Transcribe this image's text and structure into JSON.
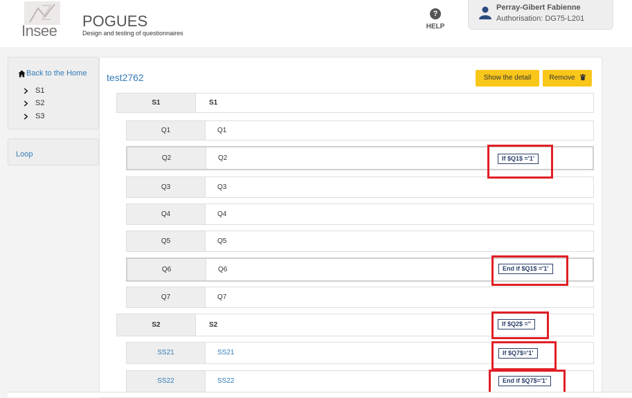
{
  "header": {
    "logo_text": "Insee",
    "app_title": "POGUES",
    "app_subtitle": "Design and testing of questionnaires",
    "help_label": "HELP",
    "user_name": "Perray-Gibert Fabienne",
    "user_authorisation": "Authorisation: DG75-L201"
  },
  "sidebar": {
    "home_label": "Back to the Home",
    "items": [
      "S1",
      "S2",
      "S3"
    ],
    "loop_label": "Loop"
  },
  "main": {
    "questionnaire_title": "test2762",
    "show_detail_label": "Show the detail",
    "remove_label": "Remove",
    "rows": [
      {
        "id": "S1",
        "label": "S1",
        "kind": "sequence"
      },
      {
        "id": "Q1",
        "label": "Q1",
        "kind": "question"
      },
      {
        "id": "Q2",
        "label": "Q2",
        "kind": "question",
        "filter": "If $Q1$ ='1'"
      },
      {
        "id": "Q3",
        "label": "Q3",
        "kind": "question"
      },
      {
        "id": "Q4",
        "label": "Q4",
        "kind": "question"
      },
      {
        "id": "Q5",
        "label": "Q5",
        "kind": "question"
      },
      {
        "id": "Q6",
        "label": "Q6",
        "kind": "question",
        "filter": "End if $Q1$ ='1'"
      },
      {
        "id": "Q7",
        "label": "Q7",
        "kind": "question"
      },
      {
        "id": "S2",
        "label": "S2",
        "kind": "sequence",
        "filter": "If $Q2$ =''"
      },
      {
        "id": "SS21",
        "label": "SS21",
        "kind": "subsequence",
        "filter": "If $Q7$='1'"
      },
      {
        "id": "SS22",
        "label": "SS22",
        "kind": "subsequence",
        "filter": "End if $Q7$='1'"
      }
    ]
  },
  "colors": {
    "accent_button": "#f9c61a",
    "link": "#337ab7",
    "highlight": "#e01e25",
    "filter_text": "#2b3f6a"
  },
  "icons": [
    "help-icon",
    "user-icon",
    "home-icon",
    "chevron-right-icon",
    "trash-icon"
  ]
}
